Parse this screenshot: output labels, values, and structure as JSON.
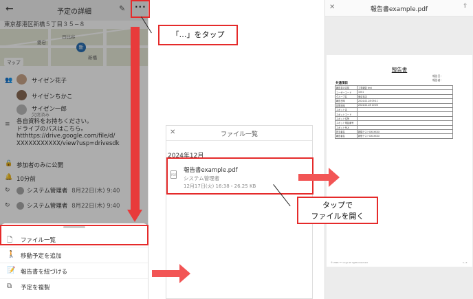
{
  "detail": {
    "title": "予定の詳細",
    "address": "東京都港区新橋５丁目３５−８",
    "map": {
      "labels": [
        "愛宕",
        "日比谷",
        "新橋"
      ],
      "pin": "新",
      "chip": "マップ"
    },
    "attendees": [
      {
        "name": "サイゼン花子",
        "sub": ""
      },
      {
        "name": "サイゼンちかこ",
        "sub": ""
      },
      {
        "name": "サイゼン一郎",
        "sub": "欠席済み"
      }
    ],
    "memo": "各自資料をお持ちください。\nドライブのパスはこちら。\nhtthttps://drive.google.com/file/d/\nXXXXXXXXXXX/view?usp=drivesdk",
    "visibility": "参加者のみに公開",
    "reminder": "10分前",
    "logs": [
      {
        "name": "システム管理者",
        "date": "8月22日(木) 9:40"
      },
      {
        "name": "システム管理者",
        "date": "8月22日(木) 9:40"
      }
    ],
    "menu": [
      {
        "label": "ファイル一覧",
        "icon": "document-icon"
      },
      {
        "label": "移動予定を追加",
        "icon": "walking-icon"
      },
      {
        "label": "報告書を紐づける",
        "icon": "report-icon"
      },
      {
        "label": "予定を複製",
        "icon": "copy-icon"
      }
    ]
  },
  "file_list": {
    "title": "ファイル一覧",
    "month": "2024年12月",
    "file": {
      "name": "報告書example.pdf",
      "owner": "システム管理者",
      "meta": "12月17日(火) 16:38・26.25 KB"
    }
  },
  "pdf_viewer": {
    "title": "報告書example.pdf",
    "doc_title": "報告書",
    "reporter_labels": [
      "報告日：",
      "報告者："
    ],
    "section": "共通項目",
    "rows": [
      [
        "報告書の名前",
        "工事報告 test"
      ],
      [
        "ユーザーコード",
        "1001"
      ],
      [
        "グループ名",
        "東京支店"
      ],
      [
        "報告日時",
        "2024-02-28 09:11"
      ],
      [
        "訪問日時",
        "2024-02-28 10:00"
      ],
      [
        "スポット名",
        ""
      ],
      [
        "スポットコード",
        ""
      ],
      [
        "スポット住所",
        ""
      ],
      [
        "スポット電話番号",
        ""
      ],
      [
        "スポットFAX",
        ""
      ],
      [
        "担当者名",
        "新橋テストXXXXXXX"
      ],
      [
        "報告者名",
        "新宿テストXXXXXXX"
      ]
    ],
    "footer": "© 2024 ***.co.jp All rights reserved.",
    "page": "1 / 1"
  },
  "annotations": {
    "tap_more": "「…」をタップ",
    "tap_open_line1": "タップで",
    "tap_open_line2": "ファイルを開く",
    "color": "#e52a2a"
  }
}
